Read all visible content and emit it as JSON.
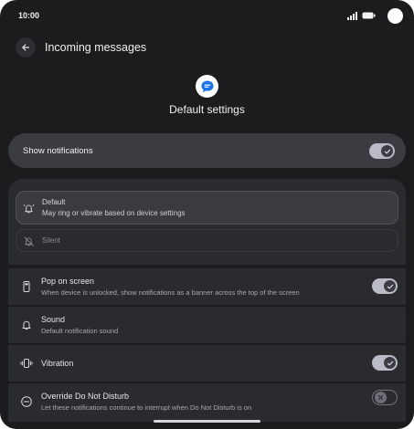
{
  "status_bar": {
    "time": "10:00"
  },
  "header": {
    "title": "Incoming messages"
  },
  "channel": {
    "title": "Default settings"
  },
  "master": {
    "label": "Show notifications",
    "enabled": true
  },
  "alert_options": [
    {
      "title": "Default",
      "subtitle": "May ring or vibrate based on device settings",
      "selected": true
    },
    {
      "title": "Silent",
      "selected": false
    }
  ],
  "settings": [
    {
      "title": "Pop on screen",
      "subtitle": "When device is unlocked, show notifications as a banner across the top of the screen",
      "enabled": true
    },
    {
      "title": "Sound",
      "subtitle": "Default notification sound"
    },
    {
      "title": "Vibration",
      "enabled": true
    },
    {
      "title": "Override Do Not Disturb",
      "subtitle": "Let these notifications continue to interrupt when Do Not Disturb is on",
      "enabled": false
    }
  ],
  "icons": {
    "back": "arrow-left-icon",
    "app": "messages-app-icon",
    "default_alert": "bell-ring-icon",
    "silent_alert": "bell-off-icon",
    "pop_on_screen": "phone-banner-icon",
    "sound": "bell-icon",
    "vibration": "vibrate-icon",
    "override_dnd": "do-not-disturb-icon"
  },
  "colors": {
    "background": "#1c1c1e",
    "card": "#2a2b2f",
    "toggle_on": "#b9bcc6",
    "app_accent": "#1a73e8"
  }
}
